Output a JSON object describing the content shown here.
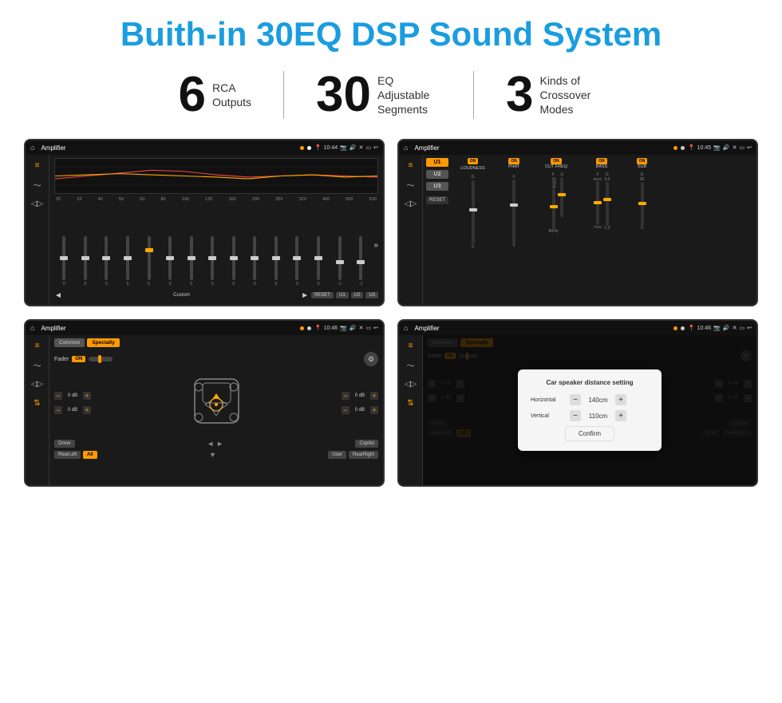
{
  "title": "Buith-in 30EQ DSP Sound System",
  "stats": [
    {
      "number": "6",
      "desc_line1": "RCA",
      "desc_line2": "Outputs"
    },
    {
      "number": "30",
      "desc_line1": "EQ Adjustable",
      "desc_line2": "Segments"
    },
    {
      "number": "3",
      "desc_line1": "Kinds of",
      "desc_line2": "Crossover Modes"
    }
  ],
  "screens": [
    {
      "id": "screen1",
      "statusbar": {
        "time": "10:44",
        "title": "Amplifier"
      },
      "type": "eq"
    },
    {
      "id": "screen2",
      "statusbar": {
        "time": "10:45",
        "title": "Amplifier"
      },
      "type": "amp2"
    },
    {
      "id": "screen3",
      "statusbar": {
        "time": "10:46",
        "title": "Amplifier"
      },
      "type": "fader"
    },
    {
      "id": "screen4",
      "statusbar": {
        "time": "10:46",
        "title": "Amplifier"
      },
      "type": "fader-dialog"
    }
  ],
  "eq": {
    "freq_labels": [
      "25",
      "32",
      "40",
      "50",
      "63",
      "80",
      "100",
      "125",
      "160",
      "200",
      "250",
      "320",
      "400",
      "500",
      "630"
    ],
    "sliders": [
      {
        "value": "0",
        "pos": 50
      },
      {
        "value": "0",
        "pos": 50
      },
      {
        "value": "0",
        "pos": 50
      },
      {
        "value": "0",
        "pos": 50
      },
      {
        "value": "5",
        "pos": 35
      },
      {
        "value": "0",
        "pos": 50
      },
      {
        "value": "0",
        "pos": 50
      },
      {
        "value": "0",
        "pos": 50
      },
      {
        "value": "0",
        "pos": 50
      },
      {
        "value": "0",
        "pos": 50
      },
      {
        "value": "0",
        "pos": 50
      },
      {
        "value": "0",
        "pos": 50
      },
      {
        "value": "0",
        "pos": 50
      },
      {
        "value": "-1",
        "pos": 55
      },
      {
        "value": "-1",
        "pos": 55
      }
    ],
    "preset": "Custom",
    "buttons": [
      "RESET",
      "U1",
      "U2",
      "U3"
    ]
  },
  "amp2": {
    "presets": [
      "U1",
      "U2",
      "U3"
    ],
    "channels": [
      {
        "name": "LOUDNESS",
        "on": true
      },
      {
        "name": "PHAT",
        "on": true
      },
      {
        "name": "CUT FREQ",
        "on": true
      },
      {
        "name": "BASS",
        "on": true
      },
      {
        "name": "SUB",
        "on": true
      }
    ]
  },
  "fader": {
    "tabs": [
      "Common",
      "Specialty"
    ],
    "active_tab": 1,
    "fader_label": "Fader",
    "fader_on": "ON",
    "left_vols": [
      "0 dB",
      "0 dB"
    ],
    "right_vols": [
      "0 dB",
      "0 dB"
    ],
    "bottom_btns": [
      "Driver",
      "",
      "",
      "",
      "Copilot"
    ],
    "bottom_btns2": [
      "RearLeft",
      "All",
      "",
      "User",
      "RearRight"
    ]
  },
  "dialog": {
    "title": "Car speaker distance setting",
    "horizontal_label": "Horizontal",
    "horizontal_value": "140cm",
    "vertical_label": "Vertical",
    "vertical_value": "110cm",
    "confirm_label": "Confirm"
  }
}
